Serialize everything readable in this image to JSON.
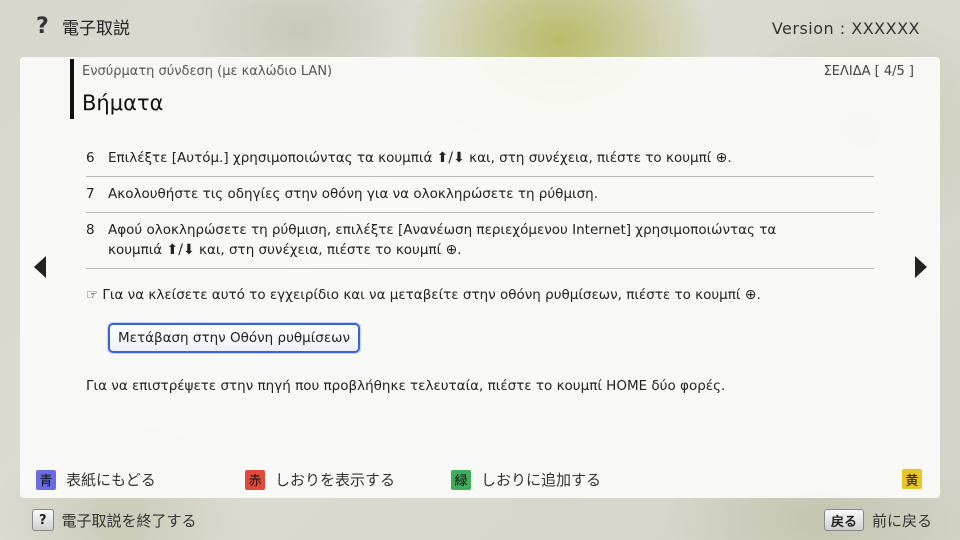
{
  "header": {
    "help_glyph": "?",
    "app_title": "電子取説",
    "version": "Version : XXXXXX"
  },
  "panel": {
    "breadcrumb": "Ενσύρματη σύνδεση (με καλώδιο LAN)",
    "page_indicator": "ΣΕΛΙΔΑ [ 4/5 ]",
    "title": "Βήματα",
    "steps": [
      {
        "num": "6",
        "text_a": "Επιλέξτε [Αυτόμ.] χρησιμοποιώντας τα κουμπιά",
        "text_b": "και, στη συνέχεια, πιέστε το κουμπί",
        "text_c": "."
      },
      {
        "num": "7",
        "text": "Ακολουθήστε τις οδηγίες στην οθόνη για να ολοκληρώσετε τη ρύθμιση."
      },
      {
        "num": "8",
        "line1": "Αφού ολοκληρώσετε τη ρύθμιση, επιλέξτε [Ανανέωση περιεχόμενου Internet] χρησιμοποιώντας τα",
        "text_a": "κουμπιά",
        "text_b": "και, στη συνέχεια, πιέστε το κουμπί",
        "text_c": "."
      }
    ],
    "note": {
      "glyph": "☞",
      "text": "Για να κλείσετε αυτό το εγχειρίδιο και να μεταβείτε στην οθόνη ρυθμίσεων, πιέστε το κουμπί",
      "end": "."
    },
    "goto_button_label": "Μετάβαση στην Οθόνη ρυθμίσεων",
    "return_text": "Για να επιστρέψετε στην πηγή που προβλήθηκε τελευταία, πιέστε το κουμπί HOME δύο φορές.",
    "glyphs": {
      "up_down": "⬆/⬇",
      "enter": "⊕"
    },
    "color_keys": [
      {
        "badge": "青",
        "label": "表紙にもどる",
        "color": "#6a6de0"
      },
      {
        "badge": "赤",
        "label": "しおりを表示する",
        "color": "#e04a3c"
      },
      {
        "badge": "緑",
        "label": "しおりに追加する",
        "color": "#3fae5c"
      },
      {
        "badge": "黄",
        "label": "",
        "color": "#e8c62a"
      }
    ]
  },
  "footer": {
    "exit_key": "?",
    "exit_label": "電子取説を終了する",
    "back_key": "戻る",
    "back_label": "前に戻る"
  },
  "icons": {
    "prev": "triangle-left",
    "next": "triangle-right"
  }
}
